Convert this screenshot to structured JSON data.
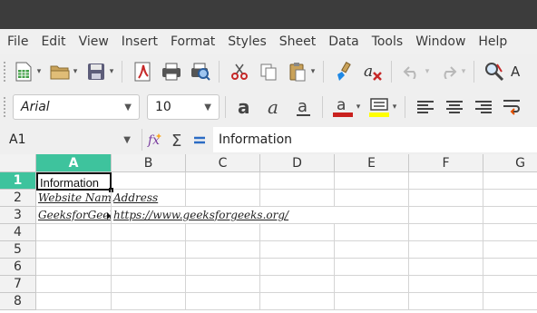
{
  "menu": [
    "File",
    "Edit",
    "View",
    "Insert",
    "Format",
    "Styles",
    "Sheet",
    "Data",
    "Tools",
    "Window",
    "Help"
  ],
  "toolbar": {
    "font_name": "Arial",
    "font_size": "10"
  },
  "formula_bar": {
    "name_box": "A1",
    "content": "Information"
  },
  "columns": [
    "A",
    "B",
    "C",
    "D",
    "E",
    "F",
    "G"
  ],
  "rows": [
    "1",
    "2",
    "3",
    "4",
    "5",
    "6",
    "7",
    "8"
  ],
  "cells": {
    "A1": "Information",
    "A2": "Website Name",
    "B2": "Address",
    "A3": "GeeksforGeeks",
    "B3": "https://www.geeksforgeeks.org/"
  },
  "colors": {
    "selection_header": "#3ec39d",
    "font_color_bar": "#c9211e",
    "highlight_bar": "#ffff00"
  }
}
